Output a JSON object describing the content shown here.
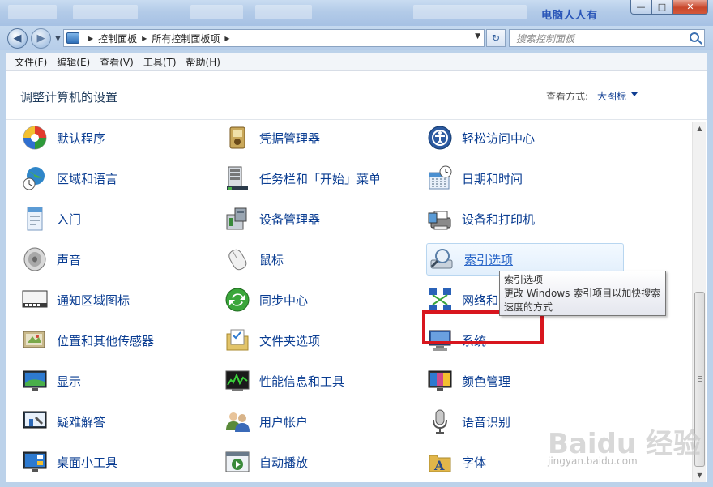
{
  "window": {
    "watermark": "电脑人人有",
    "controls": {
      "minimize": "—",
      "maximize": "□",
      "close": "✕"
    }
  },
  "nav": {
    "breadcrumbs": [
      "控制面板",
      "所有控制面板项"
    ],
    "search_placeholder": "搜索控制面板"
  },
  "menu": [
    "文件(F)",
    "编辑(E)",
    "查看(V)",
    "工具(T)",
    "帮助(H)"
  ],
  "header": {
    "title": "调整计算机的设置",
    "view_label": "查看方式:",
    "view_value": "大图标"
  },
  "items": [
    {
      "label": "默认程序",
      "icon": "default-programs-icon",
      "color": "#2e9a3a"
    },
    {
      "label": "凭据管理器",
      "icon": "credential-manager-icon",
      "color": "#b08a3e"
    },
    {
      "label": "轻松访问中心",
      "icon": "ease-of-access-icon",
      "color": "#2c5aa0"
    },
    {
      "label": "区域和语言",
      "icon": "region-language-icon",
      "color": "#2f86c9"
    },
    {
      "label": "任务栏和「开始」菜单",
      "icon": "taskbar-start-menu-icon",
      "color": "#5a6a7a"
    },
    {
      "label": "日期和时间",
      "icon": "date-time-icon",
      "color": "#4a8fd0"
    },
    {
      "label": "入门",
      "icon": "getting-started-icon",
      "color": "#5b9bd5"
    },
    {
      "label": "设备管理器",
      "icon": "device-manager-icon",
      "color": "#7a8694"
    },
    {
      "label": "设备和打印机",
      "icon": "devices-printers-icon",
      "color": "#6a6a6a"
    },
    {
      "label": "声音",
      "icon": "sound-icon",
      "color": "#8c8c8c"
    },
    {
      "label": "鼠标",
      "icon": "mouse-icon",
      "color": "#9a9a9a"
    },
    {
      "label": "索引选项",
      "icon": "indexing-options-icon",
      "color": "#5a7fa8"
    },
    {
      "label": "通知区域图标",
      "icon": "notification-area-icon",
      "color": "#4a4a4a"
    },
    {
      "label": "同步中心",
      "icon": "sync-center-icon",
      "color": "#3aa63a"
    },
    {
      "label": "网络和",
      "icon": "network-sharing-icon",
      "color": "#2a62b8"
    },
    {
      "label": "位置和其他传感器",
      "icon": "location-sensors-icon",
      "color": "#8a7a5a"
    },
    {
      "label": "文件夹选项",
      "icon": "folder-options-icon",
      "color": "#e2c46a"
    },
    {
      "label": "系统",
      "icon": "system-icon",
      "color": "#3a6ab8"
    },
    {
      "label": "显示",
      "icon": "display-icon",
      "color": "#2d7ad0"
    },
    {
      "label": "性能信息和工具",
      "icon": "performance-tools-icon",
      "color": "#3a8a3a"
    },
    {
      "label": "颜色管理",
      "icon": "color-management-icon",
      "color": "#d04a8a"
    },
    {
      "label": "疑难解答",
      "icon": "troubleshooting-icon",
      "color": "#2d6ab8"
    },
    {
      "label": "用户帐户",
      "icon": "user-accounts-icon",
      "color": "#5a8a3a"
    },
    {
      "label": "语音识别",
      "icon": "speech-recognition-icon",
      "color": "#7a7a7a"
    },
    {
      "label": "桌面小工具",
      "icon": "desktop-gadgets-icon",
      "color": "#2d7ad0"
    },
    {
      "label": "自动播放",
      "icon": "autoplay-icon",
      "color": "#3a8a3a"
    },
    {
      "label": "字体",
      "icon": "fonts-icon",
      "color": "#e2b64a"
    }
  ],
  "tooltip": {
    "title": "索引选项",
    "line1": "更改 Windows 索引项目以加快搜索",
    "line2": "速度的方式"
  },
  "watermark": {
    "baidu": "Baidu 经验",
    "url": "jingyan.baidu.com"
  }
}
